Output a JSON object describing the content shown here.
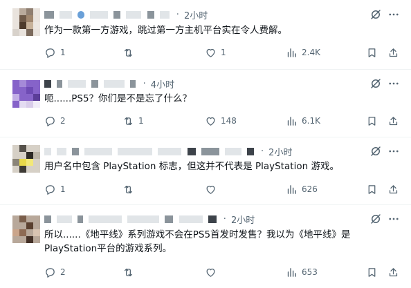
{
  "replies": [
    {
      "time": "2小时",
      "text": "作为一款第一方游戏，跳过第一方主机平台实在令人费解。",
      "stats": {
        "replies": "1",
        "reposts": "",
        "likes": "1",
        "views": "2.4K"
      }
    },
    {
      "time": "4小时",
      "text": "呃......PS5？你们是不是忘了什么？",
      "stats": {
        "replies": "2",
        "reposts": "1",
        "likes": "148",
        "views": "6.1K"
      }
    },
    {
      "time": "2小时",
      "text": "用户名中包含 PlayStation 标志，但这并不代表是 PlayStation 游戏。",
      "stats": {
        "replies": "1",
        "reposts": "",
        "likes": "",
        "views": "626"
      }
    },
    {
      "time": "2小时",
      "text_line1": "所以......《地平线》系列游戏不会在PS5首发时发售？我以为《地平线》是",
      "text_line2": "PlayStation平台的游戏系列。",
      "stats": {
        "replies": "2",
        "reposts": "",
        "likes": "",
        "views": "653"
      }
    }
  ],
  "icons": {
    "reply": "reply-icon",
    "repost": "repost-icon",
    "like": "like-icon",
    "views": "views-icon",
    "bookmark": "bookmark-icon",
    "share": "share-icon",
    "grok": "grok-icon",
    "more": "more-icon"
  },
  "colors": {
    "text": "#0f1419",
    "muted": "#536471",
    "divider": "#eff3f4"
  }
}
